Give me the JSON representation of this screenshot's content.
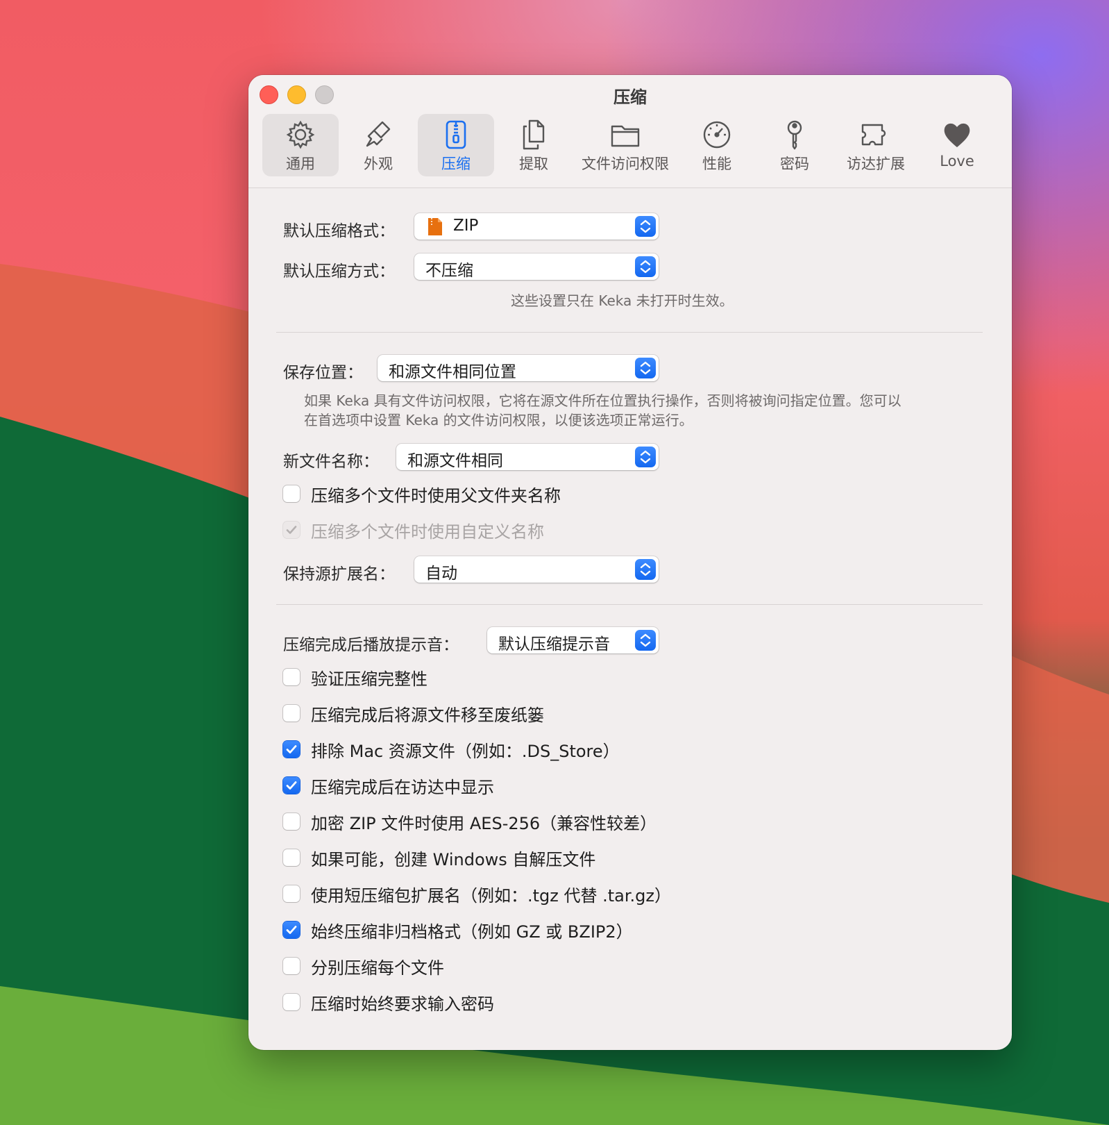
{
  "window": {
    "title": "压缩"
  },
  "toolbar": {
    "tabs": [
      {
        "id": "general",
        "label": "通用",
        "icon": "gear-icon"
      },
      {
        "id": "appearance",
        "label": "外观",
        "icon": "brush-icon"
      },
      {
        "id": "compression",
        "label": "压缩",
        "icon": "zipper-icon",
        "active": true
      },
      {
        "id": "extraction",
        "label": "提取",
        "icon": "documents-icon"
      },
      {
        "id": "file-access",
        "label": "文件访问权限",
        "icon": "folder-icon"
      },
      {
        "id": "performance",
        "label": "性能",
        "icon": "speedometer-icon"
      },
      {
        "id": "password",
        "label": "密码",
        "icon": "key-icon"
      },
      {
        "id": "finder-extension",
        "label": "访达扩展",
        "icon": "puzzle-icon"
      },
      {
        "id": "love",
        "label": "Love",
        "icon": "heart-icon"
      }
    ]
  },
  "format_section": {
    "format_label": "默认压缩格式：",
    "format_value": "ZIP",
    "format_icon": "zip-file-icon",
    "method_label": "默认压缩方式：",
    "method_value": "不压缩",
    "note": "这些设置只在 Keka 未打开时生效。"
  },
  "save_section": {
    "location_label": "保存位置：",
    "location_value": "和源文件相同位置",
    "location_note_line1": "如果 Keka 具有文件访问权限，它将在源文件所在位置执行操作，否则将被询问指定位置。您可以",
    "location_note_line2": "在首选项中设置 Keka 的文件访问权限，以便该选项正常运行。",
    "filename_label": "新文件名称：",
    "filename_value": "和源文件相同",
    "use_parent_folder": "压缩多个文件时使用父文件夹名称",
    "use_custom_name": "压缩多个文件时使用自定义名称",
    "keep_ext_label": "保持源扩展名：",
    "keep_ext_value": "自动"
  },
  "after_section": {
    "sound_label": "压缩完成后播放提示音：",
    "sound_value": "默认压缩提示音",
    "options": [
      {
        "label": "验证压缩完整性",
        "checked": false
      },
      {
        "label": "压缩完成后将源文件移至废纸篓",
        "checked": false
      },
      {
        "label": "排除 Mac 资源文件（例如：.DS_Store）",
        "checked": true
      },
      {
        "label": "压缩完成后在访达中显示",
        "checked": true
      },
      {
        "label": "加密 ZIP 文件时使用 AES-256（兼容性较差）",
        "checked": false
      },
      {
        "label": "如果可能，创建 Windows 自解压文件",
        "checked": false
      },
      {
        "label": "使用短压缩包扩展名（例如：.tgz 代替 .tar.gz）",
        "checked": false
      },
      {
        "label": "始终压缩非归档格式（例如 GZ 或 BZIP2）",
        "checked": true
      },
      {
        "label": "分别压缩每个文件",
        "checked": false
      },
      {
        "label": "压缩时始终要求输入密码",
        "checked": false
      }
    ]
  },
  "colors": {
    "accent": "#1a6ff0",
    "window_bg": "#f2eeee",
    "close": "#ff5f57",
    "minimize": "#febc2e"
  }
}
